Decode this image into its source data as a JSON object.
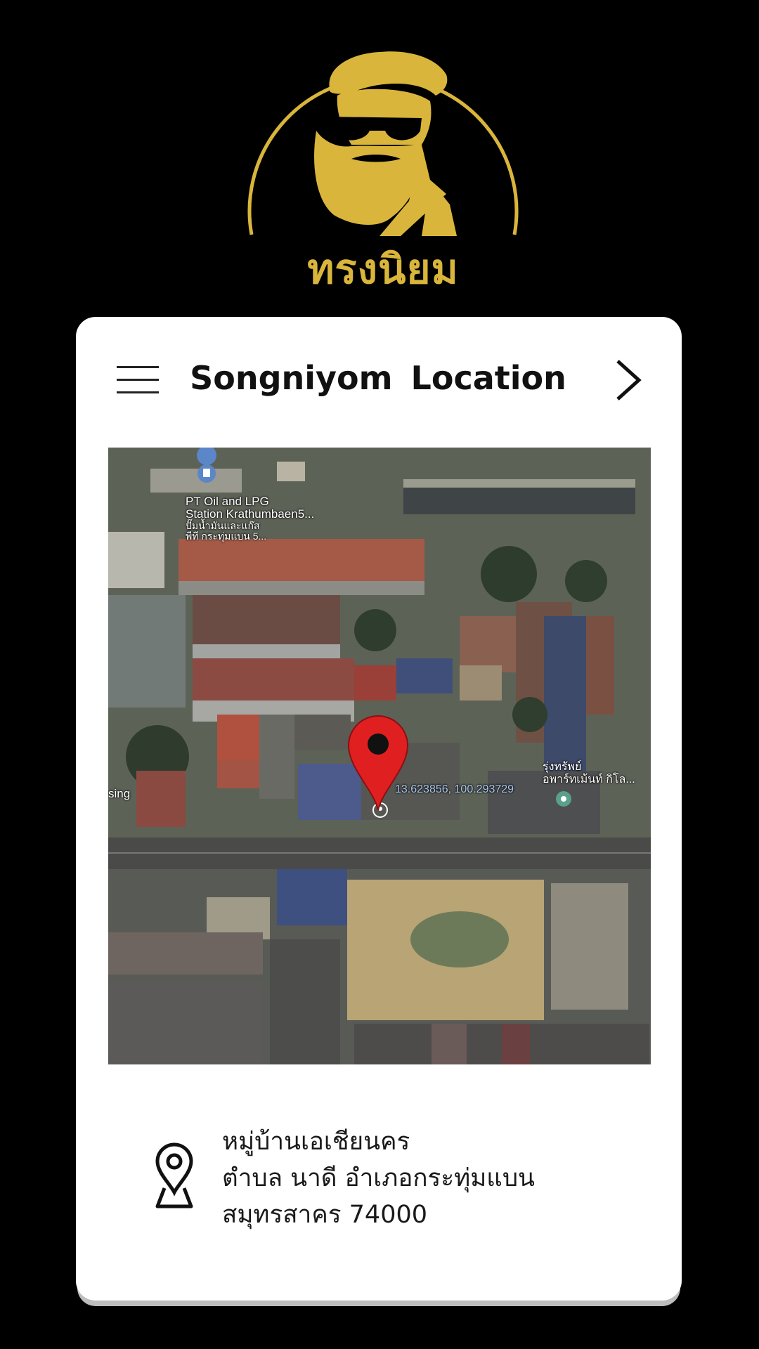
{
  "brand": {
    "logo_text": "ทรงนิยม",
    "accent_color": "#d9b53b"
  },
  "header": {
    "title": "Songniyom  Location",
    "menu_icon": "hamburger-menu-icon",
    "next_icon": "chevron-right-icon"
  },
  "map": {
    "labels": {
      "gas_station_line1": "PT Oil and LPG",
      "gas_station_line2": "Station Krathumbaen5...",
      "gas_station_line3": "ปั๊มน้ำมันและแก๊ส",
      "gas_station_line4": "พีที กระทุ่มแบน 5...",
      "coordinates": "13.623856, 100.293729",
      "apartment_line1": "รุ่งทรัพย์",
      "apartment_line2": "อพาร์ทเม้นท์ กิโล...",
      "edge_label": "sing"
    },
    "pin_color": "#e02020"
  },
  "address": {
    "icon": "location-pin-icon",
    "line1": "หมู่บ้านเอเชียนคร",
    "line2": "ตำบล นาดี อำเภอกระทุ่มแบน",
    "line3": "สมุทรสาคร 74000"
  }
}
